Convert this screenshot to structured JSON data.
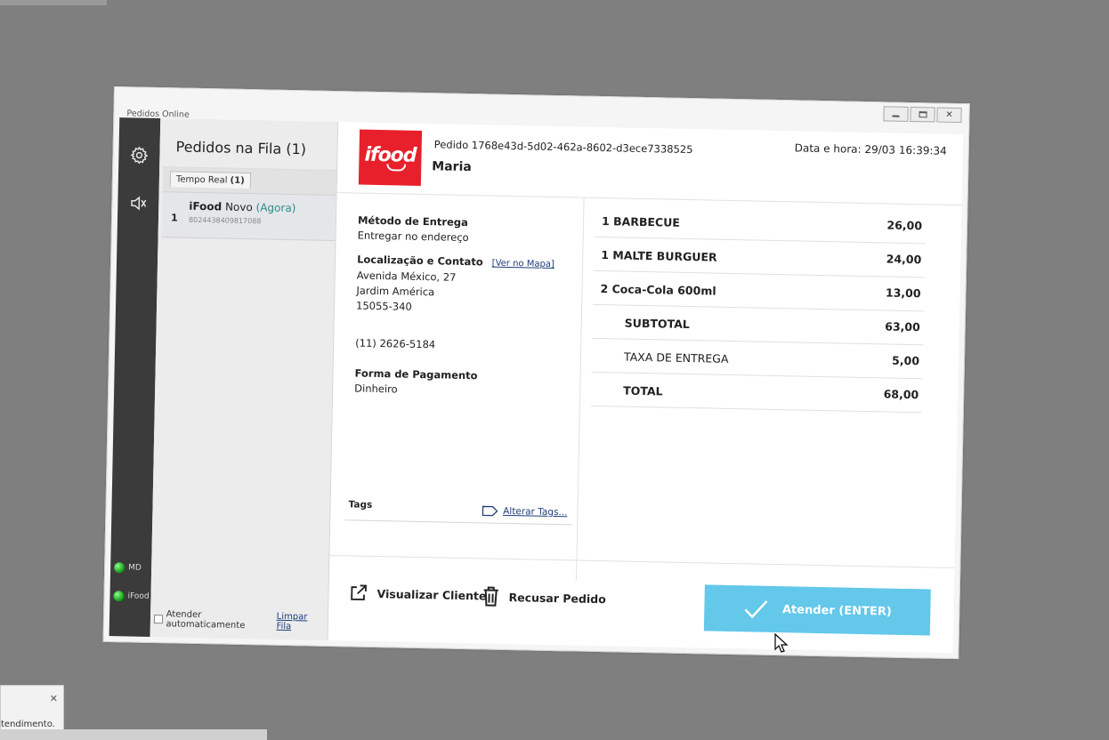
{
  "app_title": "Pedidos Online",
  "sidebar": {
    "status": [
      {
        "label": "MD",
        "color": "#22cc22"
      },
      {
        "label": "iFood",
        "color": "#22cc22"
      }
    ]
  },
  "queue": {
    "title": "Pedidos na Fila (1)",
    "tab": {
      "label": "Tempo Real",
      "count": "(1)"
    },
    "items": [
      {
        "num": "1",
        "source": "iFood",
        "status": "Novo",
        "time": "(Agora)",
        "id": "8024438409817088"
      }
    ],
    "auto_label": "Atender automaticamente",
    "clear_label": "Limpar Fila"
  },
  "order": {
    "logo_text": "ifood",
    "label": "Pedido",
    "id": "1768e43d-5d02-462a-8602-d3ece7338525",
    "customer": "Maria",
    "datetime_label": "Data e hora:",
    "datetime": "29/03 16:39:34"
  },
  "details": {
    "delivery_title": "Método de Entrega",
    "delivery_value": "Entregar no endereço",
    "location_title": "Localização e Contato",
    "map_link": "[Ver no Mapa]",
    "address_1": "Avenida México, 27",
    "address_2": "Jardim América",
    "zip": "15055-340",
    "phone": "(11) 2626-5184",
    "payment_title": "Forma de Pagamento",
    "payment_value": "Dinheiro",
    "tags_title": "Tags",
    "tags_link": "Alterar Tags..."
  },
  "items": [
    {
      "qty_name": "1 BARBECUE",
      "price": "26,00"
    },
    {
      "qty_name": "1 MALTE BURGUER",
      "price": "24,00"
    },
    {
      "qty_name": "2 Coca-Cola 600ml",
      "price": "13,00"
    }
  ],
  "totals": {
    "subtotal_label": "SUBTOTAL",
    "subtotal": "63,00",
    "fee_label": "TAXA DE ENTREGA",
    "fee": "5,00",
    "total_label": "TOTAL",
    "total": "68,00"
  },
  "actions": {
    "view_client": "Visualizar Cliente",
    "reject": "Recusar Pedido",
    "accept": "Atender (ENTER)",
    "accept_color": "#63c8ea"
  },
  "background": {
    "toast_text": "tendimento."
  }
}
